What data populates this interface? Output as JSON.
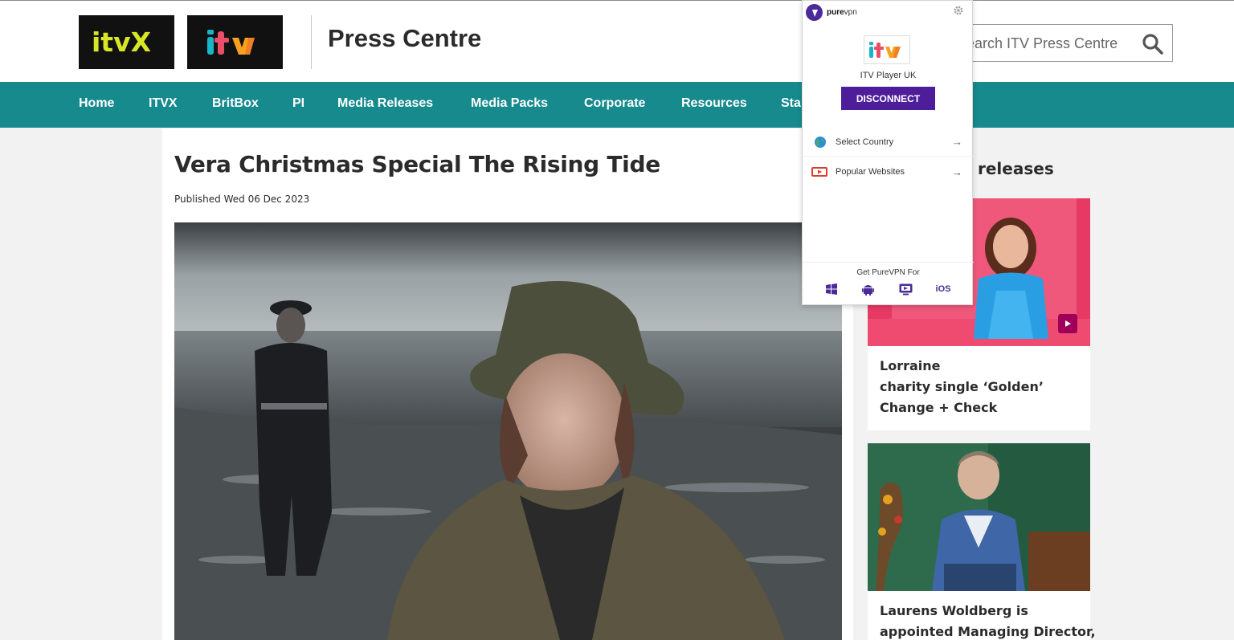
{
  "header": {
    "logo_itvx_alt": "itvX",
    "logo_itv_alt": "itv",
    "site_title": "Press Centre",
    "search_placeholder": "Search ITV Press Centre"
  },
  "nav": {
    "items": [
      {
        "label": "Home"
      },
      {
        "label": "ITVX"
      },
      {
        "label": "BritBox"
      },
      {
        "label": "PI"
      },
      {
        "label": "Media Releases"
      },
      {
        "label": "Media Packs"
      },
      {
        "label": "Corporate"
      },
      {
        "label": "Resources"
      },
      {
        "label": "Sta"
      }
    ]
  },
  "article": {
    "title": "Vera Christmas Special The Rising Tide",
    "published": "Published Wed 06 Dec 2023"
  },
  "sidebar": {
    "heading": "releases",
    "cards": [
      {
        "lines": [
          "Lorraine",
          "charity single ‘Golden’",
          "Change + Check"
        ]
      },
      {
        "lines": [
          "Laurens Woldberg is",
          "appointed Managing Director,"
        ]
      }
    ]
  },
  "vpn": {
    "brand_bold": "pure",
    "brand_rest": "vpn",
    "site_name": "ITV Player UK",
    "disconnect_label": "DISCONNECT",
    "select_country": "Select Country",
    "popular_websites": "Popular Websites",
    "arrow": "→",
    "get_for": "Get PureVPN For",
    "ios_label": "iOS"
  },
  "colors": {
    "nav_bg": "#178a8e",
    "vpn_purple": "#4d1d9a",
    "itv_badge": "#a1005a"
  }
}
